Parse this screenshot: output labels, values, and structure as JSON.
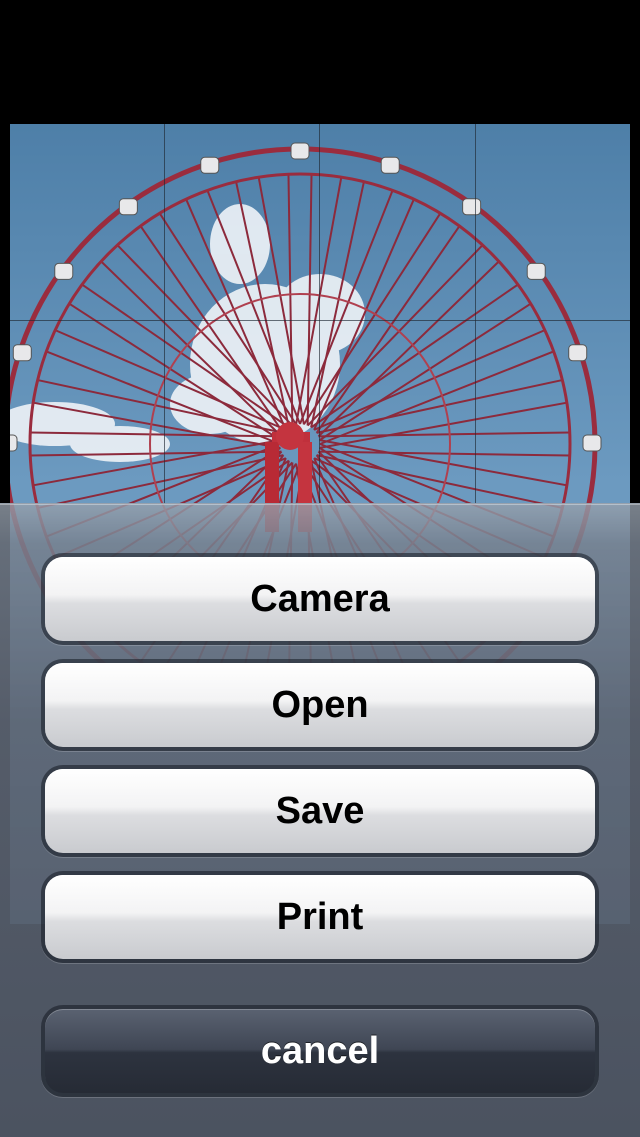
{
  "action_sheet": {
    "buttons": [
      {
        "label": "Camera"
      },
      {
        "label": "Open"
      },
      {
        "label": "Save"
      },
      {
        "label": "Print"
      }
    ],
    "cancel_label": "cancel"
  },
  "photo": {
    "subject": "ferris-wheel",
    "sky_color": "#5e8db5",
    "frame_color": "#a8283c"
  }
}
